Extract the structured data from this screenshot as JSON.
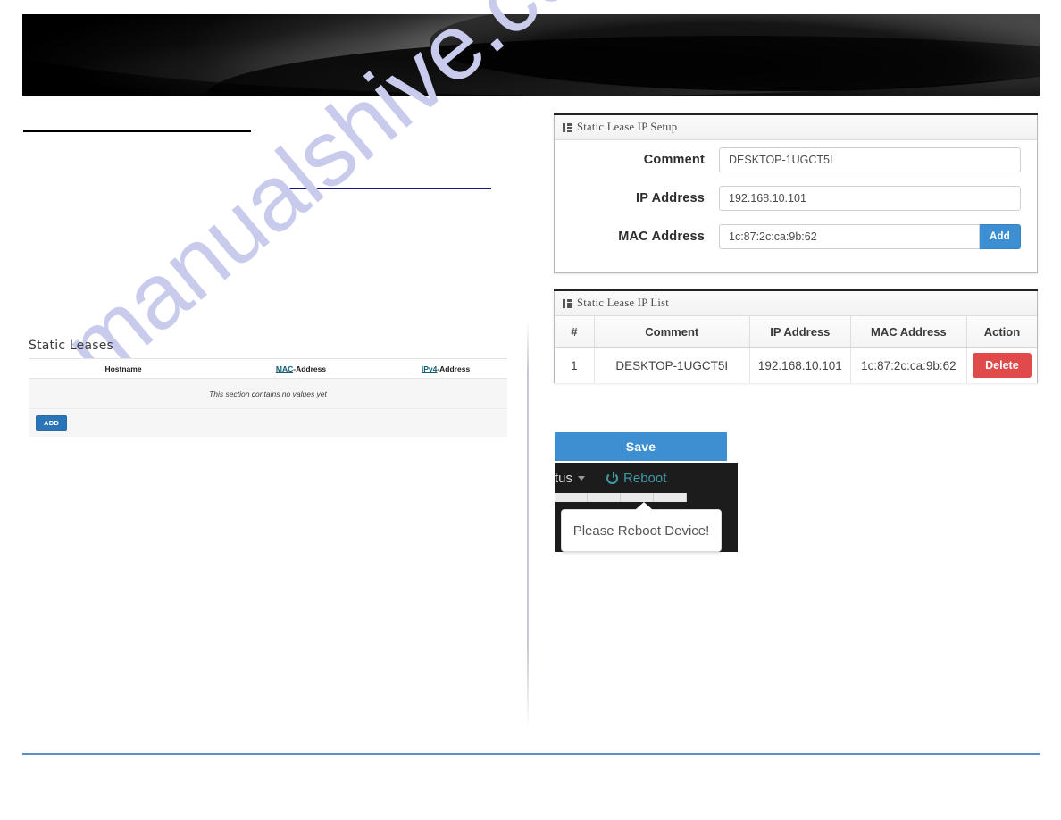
{
  "banner": {
    "name": "header-banner-image"
  },
  "watermark": {
    "text": "manualshive.com"
  },
  "left_section": {
    "title": "Static Leases",
    "columns": [
      {
        "prefix": "",
        "underlined": "",
        "rest": "Hostname"
      },
      {
        "prefix": "",
        "underlined": "MAC",
        "rest": "-Address"
      },
      {
        "prefix": "",
        "underlined": "IPv4",
        "rest": "-Address"
      }
    ],
    "column_labels": [
      "Hostname",
      "MAC-Address",
      "IPv4-Address"
    ],
    "empty_message": "This section contains no values yet",
    "add_button_label": "ADD"
  },
  "setup_panel": {
    "header_title": "Static Lease IP Setup",
    "header_icon": "grid-icon",
    "fields": [
      {
        "label": "Comment",
        "value": "DESKTOP-1UGCT5I"
      },
      {
        "label": "IP Address",
        "value": "192.168.10.101"
      },
      {
        "label": "MAC Address",
        "value": "1c:87:2c:ca:9b:62"
      }
    ],
    "add_button_label": "Add"
  },
  "list_panel": {
    "header_title": "Static Lease IP List",
    "header_icon": "grid-icon",
    "columns": [
      "#",
      "Comment",
      "IP Address",
      "MAC Address",
      "Action"
    ],
    "rows": [
      {
        "num": "1",
        "comment": "DESKTOP-1UGCT5I",
        "ip": "192.168.10.101",
        "mac": "1c:87:2c:ca:9b:62",
        "action": "Delete"
      }
    ]
  },
  "save_button": {
    "label": "Save"
  },
  "navbar": {
    "status_label": "tus",
    "reboot_label": "Reboot",
    "reboot_icon": "power-icon"
  },
  "tooltip": {
    "text": "Please Reboot Device!"
  },
  "colors": {
    "primary_blue": "#3d8fd1",
    "danger_red": "#e04a4a",
    "navy_rule": "#16167f",
    "footer_rule": "#5b8fc9",
    "teal_link": "#0c5c72",
    "navbar_bg": "#1c1c1c",
    "reboot_teal": "#3f9aa8",
    "watermark": "#c9cbed"
  }
}
